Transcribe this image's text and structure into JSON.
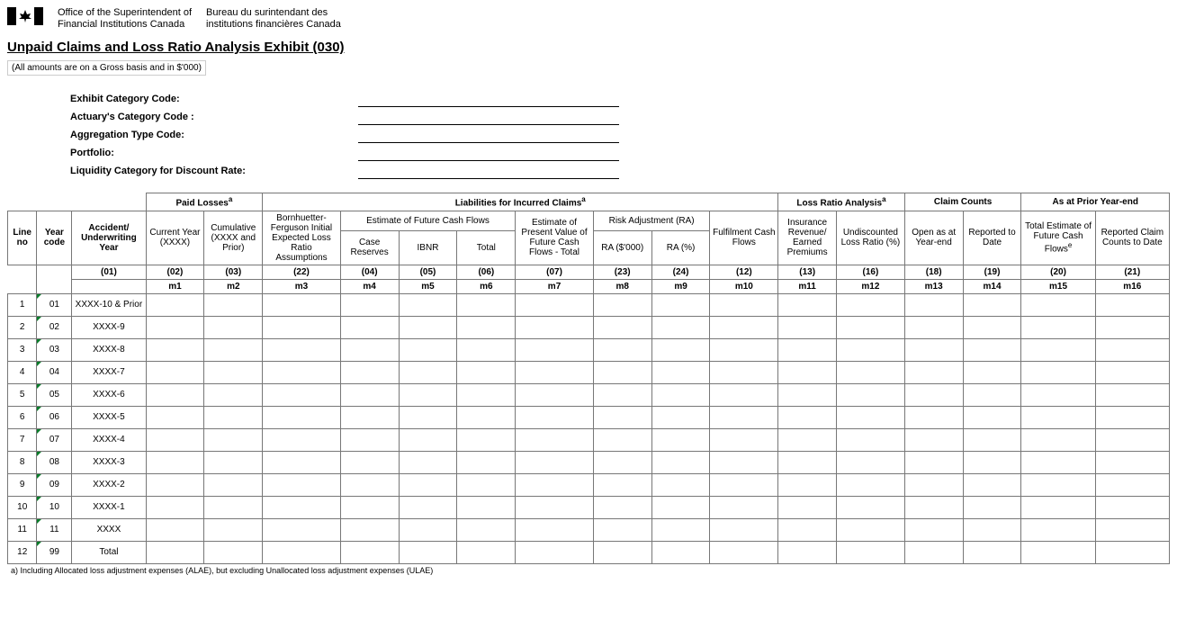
{
  "org": {
    "en_line1": "Office of the Superintendent of",
    "en_line2": "Financial Institutions Canada",
    "fr_line1": "Bureau du surintendant des",
    "fr_line2": "institutions financières Canada"
  },
  "title": "Unpaid Claims and Loss Ratio Analysis Exhibit (030)",
  "subnote": "(All amounts are on a Gross basis and in $'000)",
  "meta": {
    "exhibit": "Exhibit Category Code:",
    "actuary": "Actuary's Category Code :",
    "aggregation": "Aggregation Type Code:",
    "portfolio": "Portfolio:",
    "liquidity": "Liquidity Category for Discount Rate:"
  },
  "groups": {
    "paid_losses": "Paid Losses",
    "liabilities": "Liabilities for Incurred Claims",
    "loss_ratio": "Loss Ratio Analysis",
    "claim_counts": "Claim Counts",
    "prior_year": "As at Prior Year-end"
  },
  "headers": {
    "line_no": "Line no",
    "year_code": "Year code",
    "accident": "Accident/ Underwriting Year",
    "current_year": "Current Year (XXXX)",
    "cumulative": "Cumulative (XXXX and Prior)",
    "bf": "Bornhuetter-Ferguson Initial Expected Loss Ratio Assumptions",
    "est_future": "Estimate of Future Cash Flows",
    "case_reserves": "Case Reserves",
    "ibnr": "IBNR",
    "total": "Total",
    "est_pv": "Estimate of Present Value of Future Cash Flows - Total",
    "ra": "Risk Adjustment (RA)",
    "ra_000": "RA ($'000)",
    "ra_pct": "RA (%)",
    "fulfilment": "Fulfilment Cash Flows",
    "ins_rev": "Insurance Revenue/ Earned Premiums",
    "undisc": "Undiscounted Loss Ratio (%)",
    "open_as_at": "Open as at Year-end",
    "reported": "Reported to Date",
    "total_est": "Total Estimate of Future Cash Flows",
    "reported_claim": "Reported Claim Counts to Date"
  },
  "colcodes": {
    "c01": "(01)",
    "c02": "(02)",
    "c03": "(03)",
    "c22": "(22)",
    "c04": "(04)",
    "c05": "(05)",
    "c06": "(06)",
    "c07": "(07)",
    "c23": "(23)",
    "c24": "(24)",
    "c12": "(12)",
    "c13": "(13)",
    "c16": "(16)",
    "c18": "(18)",
    "c19": "(19)",
    "c20": "(20)",
    "c21": "(21)"
  },
  "mcodes": {
    "m1": "m1",
    "m2": "m2",
    "m3": "m3",
    "m4": "m4",
    "m5": "m5",
    "m6": "m6",
    "m7": "m7",
    "m8": "m8",
    "m9": "m9",
    "m10": "m10",
    "m11": "m11",
    "m12": "m12",
    "m13": "m13",
    "m14": "m14",
    "m15": "m15",
    "m16": "m16"
  },
  "rows": [
    {
      "line": "1",
      "year": "01",
      "acc": "XXXX-10 & Prior"
    },
    {
      "line": "2",
      "year": "02",
      "acc": "XXXX-9"
    },
    {
      "line": "3",
      "year": "03",
      "acc": "XXXX-8"
    },
    {
      "line": "4",
      "year": "04",
      "acc": "XXXX-7"
    },
    {
      "line": "5",
      "year": "05",
      "acc": "XXXX-6"
    },
    {
      "line": "6",
      "year": "06",
      "acc": "XXXX-5"
    },
    {
      "line": "7",
      "year": "07",
      "acc": "XXXX-4"
    },
    {
      "line": "8",
      "year": "08",
      "acc": "XXXX-3"
    },
    {
      "line": "9",
      "year": "09",
      "acc": "XXXX-2"
    },
    {
      "line": "10",
      "year": "10",
      "acc": "XXXX-1"
    },
    {
      "line": "11",
      "year": "11",
      "acc": "XXXX"
    },
    {
      "line": "12",
      "year": "99",
      "acc": "Total"
    }
  ],
  "footnote_a": "a) Including Allocated loss adjustment expenses (ALAE), but excluding Unallocated loss adjustment expenses (ULAE)",
  "sup_a": "a",
  "sup_e": "e"
}
